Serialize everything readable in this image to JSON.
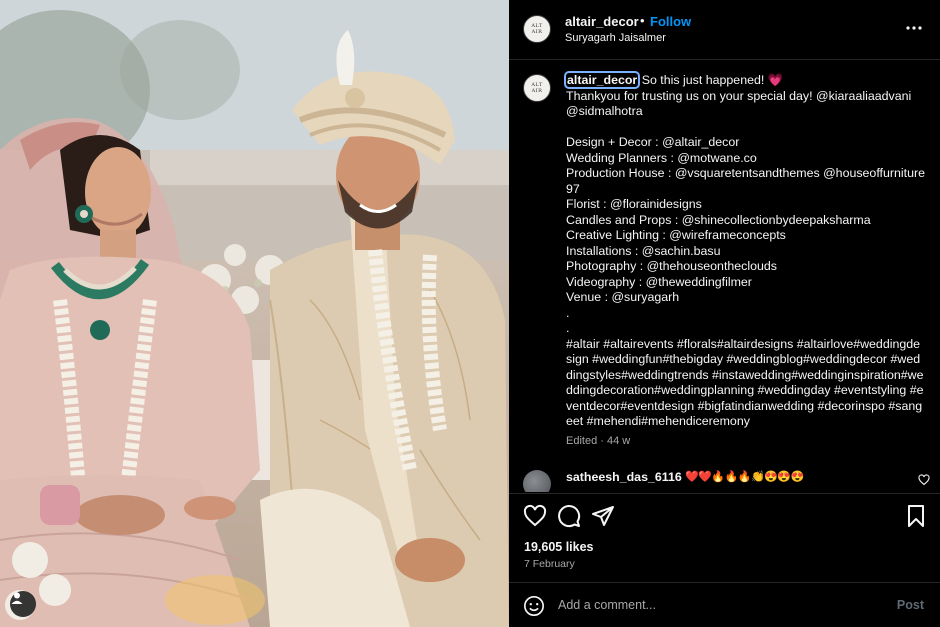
{
  "post": {
    "username": "altair_decor",
    "follow_label": "Follow",
    "dot": "•",
    "location": "Suryagarh Jaisalmer",
    "avatar_text": "ALT AIR",
    "more_icon": "more-horizontal-icon"
  },
  "caption": {
    "username": "altair_decor",
    "first_line": " So this just happened! 💗",
    "body": "Thankyou for trusting us on your special day! @kiaraaliaadvani @sidmalhotra\n\nDesign + Decor : @altair_decor\nWedding Planners : @motwane.co\nProduction House : @vsquaretentsandthemes @houseoffurniture97\nFlorist : @florainidesigns\nCandles and Props : @shinecollectionbydeepaksharma\nCreative Lighting : @wireframeconcepts\nInstallations : @sachin.basu\nPhotography : @thehouseontheclouds\nVideography : @theweddingfilmer\nVenue : @suryagarh\n.\n.\n#altair #altairevents #florals#altairdesigns #altairlove#weddingdesign #weddingfun#thebigday #weddingblog#weddingdecor #weddingstyles#weddingtrends #instawedding#weddinginspiration#weddingdecoration#weddingplanning #weddingday #eventstyling #eventdecor#eventdesign #bigfatindianwedding #decorinspo #sangeet #mehendi#mehendiceremony",
    "meta": "Edited · 44 w"
  },
  "comment": {
    "username": "satheesh_das_6116",
    "text": "❤️❤️🔥🔥🔥👏😍😍😍"
  },
  "actions": {
    "like_icon": "heart-icon",
    "comment_icon": "comment-icon",
    "share_icon": "send-icon",
    "save_icon": "bookmark-icon",
    "likes": "19,605 likes",
    "date": "7 February"
  },
  "add_comment": {
    "placeholder": "Add a comment...",
    "post_label": "Post",
    "emoji_icon": "emoji-icon"
  },
  "colors": {
    "background": "#000000",
    "text": "#f5f5f5",
    "secondary_text": "#a8a8a8",
    "follow_blue": "#0095f6",
    "border": "#262626"
  }
}
